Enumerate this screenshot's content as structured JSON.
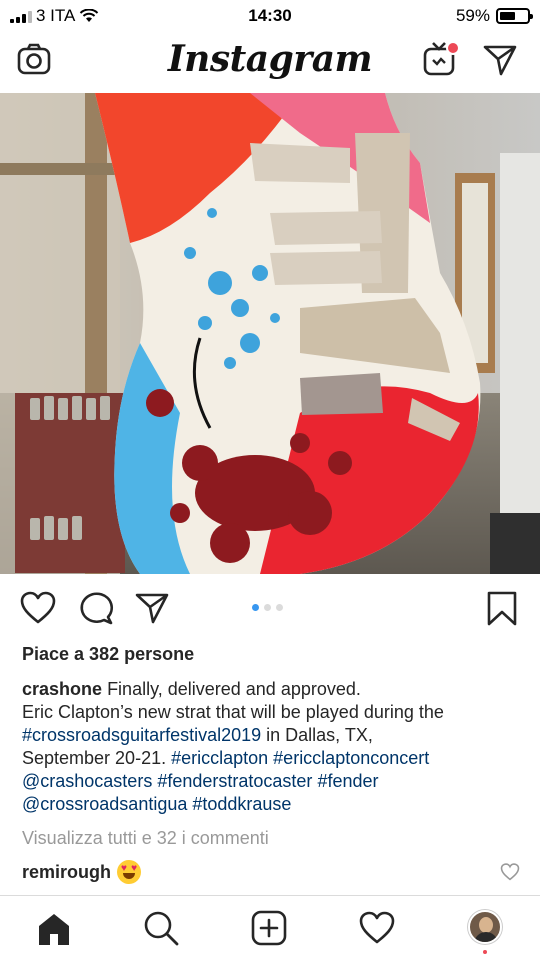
{
  "status_bar": {
    "carrier": "3 ITA",
    "time": "14:30",
    "battery_percent": "59%",
    "battery_level": 0.59,
    "signal_bars": 3,
    "icons": [
      "signal-icon",
      "wifi-icon",
      "battery-icon"
    ]
  },
  "header": {
    "logo": "Instagram",
    "icons": [
      "camera-icon",
      "igtv-icon",
      "direct-icon"
    ],
    "notification_color": "#ed4956"
  },
  "post": {
    "image_description_icon": "guitar-photo",
    "carousel": {
      "count": 3,
      "active": 1
    },
    "action_icons": [
      "heart-icon",
      "comment-icon",
      "share-icon",
      "bookmark-icon"
    ],
    "likes": "Piace a 382 persone",
    "caption": {
      "username": "crashone",
      "line1": "Finally, delivered and approved.",
      "line2": "Eric Clapton’s new strat that will be played during the",
      "tag1": "#crossroadsguitarfestival2019",
      "text3": " in Dallas, TX,",
      "text4": "September 20-21. ",
      "tag2": "#ericclapton",
      "tag3": "#ericclaptonconcert",
      "tag4": "@crashocasters",
      "tag5": "#fenderstratocaster",
      "tag6": "#fender",
      "tag7": "@crossroadsantigua",
      "tag8": "#toddkrause"
    },
    "view_comments": "Visualizza tutti e 32 i commenti",
    "comment_user": "remirough",
    "comment_emoji": "heart-eyes-emoji",
    "link_color": "#003569"
  },
  "bottom_nav": {
    "icons": [
      "home-icon",
      "search-icon",
      "new-post-icon",
      "activity-icon",
      "profile-avatar"
    ]
  }
}
